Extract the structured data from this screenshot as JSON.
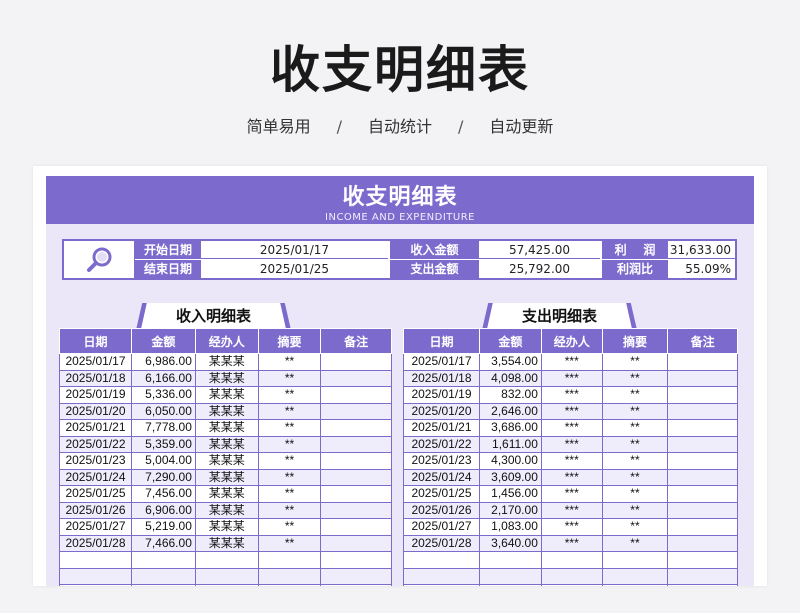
{
  "hero": {
    "title": "收支明细表",
    "tags": [
      "简单易用",
      "自动统计",
      "自动更新"
    ],
    "separator": "/"
  },
  "sheet": {
    "title": "收支明细表",
    "subtitle": "INCOME AND EXPENDITURE",
    "accent_color": "#7c6bcd",
    "icon": "search-icon",
    "summary": {
      "start_date_label": "开始日期",
      "start_date": "2025/01/17",
      "end_date_label": "结束日期",
      "end_date": "2025/01/25",
      "income_total_label": "收入金额",
      "income_total": "57,425.00",
      "expense_total_label": "支出金额",
      "expense_total": "25,792.00",
      "profit_label": "利    润",
      "profit": "31,633.00",
      "margin_label": "利润比",
      "margin": "55.09%"
    },
    "income": {
      "title": "收入明细表",
      "columns": [
        "日期",
        "金额",
        "经办人",
        "摘要",
        "备注"
      ],
      "rows": [
        [
          "2025/01/17",
          "6,986.00",
          "某某某",
          "**",
          ""
        ],
        [
          "2025/01/18",
          "6,166.00",
          "某某某",
          "**",
          ""
        ],
        [
          "2025/01/19",
          "5,336.00",
          "某某某",
          "**",
          ""
        ],
        [
          "2025/01/20",
          "6,050.00",
          "某某某",
          "**",
          ""
        ],
        [
          "2025/01/21",
          "7,778.00",
          "某某某",
          "**",
          ""
        ],
        [
          "2025/01/22",
          "5,359.00",
          "某某某",
          "**",
          ""
        ],
        [
          "2025/01/23",
          "5,004.00",
          "某某某",
          "**",
          ""
        ],
        [
          "2025/01/24",
          "7,290.00",
          "某某某",
          "**",
          ""
        ],
        [
          "2025/01/25",
          "7,456.00",
          "某某某",
          "**",
          ""
        ],
        [
          "2025/01/26",
          "6,906.00",
          "某某某",
          "**",
          ""
        ],
        [
          "2025/01/27",
          "5,219.00",
          "某某某",
          "**",
          ""
        ],
        [
          "2025/01/28",
          "7,466.00",
          "某某某",
          "**",
          ""
        ],
        [
          "",
          "",
          "",
          "",
          ""
        ],
        [
          "",
          "",
          "",
          "",
          ""
        ],
        [
          "",
          "",
          "",
          "",
          ""
        ]
      ]
    },
    "expense": {
      "title": "支出明细表",
      "columns": [
        "日期",
        "金额",
        "经办人",
        "摘要",
        "备注"
      ],
      "rows": [
        [
          "2025/01/17",
          "3,554.00",
          "***",
          "**",
          ""
        ],
        [
          "2025/01/18",
          "4,098.00",
          "***",
          "**",
          ""
        ],
        [
          "2025/01/19",
          "832.00",
          "***",
          "**",
          ""
        ],
        [
          "2025/01/20",
          "2,646.00",
          "***",
          "**",
          ""
        ],
        [
          "2025/01/21",
          "3,686.00",
          "***",
          "**",
          ""
        ],
        [
          "2025/01/22",
          "1,611.00",
          "***",
          "**",
          ""
        ],
        [
          "2025/01/23",
          "4,300.00",
          "***",
          "**",
          ""
        ],
        [
          "2025/01/24",
          "3,609.00",
          "***",
          "**",
          ""
        ],
        [
          "2025/01/25",
          "1,456.00",
          "***",
          "**",
          ""
        ],
        [
          "2025/01/26",
          "2,170.00",
          "***",
          "**",
          ""
        ],
        [
          "2025/01/27",
          "1,083.00",
          "***",
          "**",
          ""
        ],
        [
          "2025/01/28",
          "3,640.00",
          "***",
          "**",
          ""
        ],
        [
          "",
          "",
          "",
          "",
          ""
        ],
        [
          "",
          "",
          "",
          "",
          ""
        ],
        [
          "",
          "",
          "",
          "",
          ""
        ]
      ]
    }
  }
}
